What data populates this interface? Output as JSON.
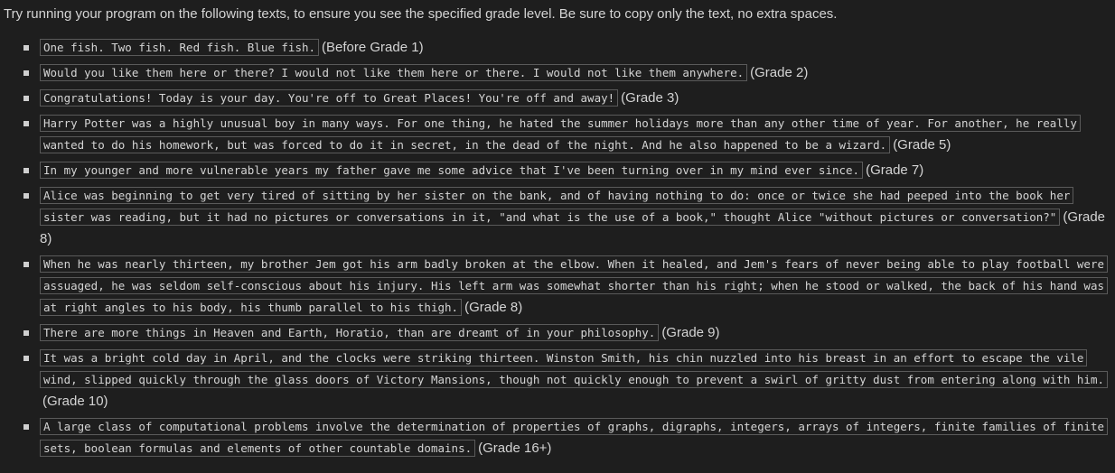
{
  "instructions": "Try running your program on the following texts, to ensure you see the specified grade level. Be sure to copy only the text, no extra spaces.",
  "items": [
    {
      "text": "One fish. Two fish. Red fish. Blue fish.",
      "grade": "(Before Grade 1)"
    },
    {
      "text": "Would you like them here or there? I would not like them here or there. I would not like them anywhere.",
      "grade": "(Grade 2)"
    },
    {
      "text": "Congratulations! Today is your day. You're off to Great Places! You're off and away!",
      "grade": "(Grade 3)"
    },
    {
      "text": "Harry Potter was a highly unusual boy in many ways. For one thing, he hated the summer holidays more than any other time of year. For another, he really wanted to do his homework, but was forced to do it in secret, in the dead of the night. And he also happened to be a wizard.",
      "grade": "(Grade 5)"
    },
    {
      "text": "In my younger and more vulnerable years my father gave me some advice that I've been turning over in my mind ever since.",
      "grade": "(Grade 7)"
    },
    {
      "text": "Alice was beginning to get very tired of sitting by her sister on the bank, and of having nothing to do: once or twice she had peeped into the book her sister was reading, but it had no pictures or conversations in it, \"and what is the use of a book,\" thought Alice \"without pictures or conversation?\"",
      "grade": "(Grade 8)"
    },
    {
      "text": "When he was nearly thirteen, my brother Jem got his arm badly broken at the elbow. When it healed, and Jem's fears of never being able to play football were assuaged, he was seldom self-conscious about his injury. His left arm was somewhat shorter than his right; when he stood or walked, the back of his hand was at right angles to his body, his thumb parallel to his thigh.",
      "grade": "(Grade 8)"
    },
    {
      "text": "There are more things in Heaven and Earth, Horatio, than are dreamt of in your philosophy.",
      "grade": "(Grade 9)"
    },
    {
      "text": "It was a bright cold day in April, and the clocks were striking thirteen. Winston Smith, his chin nuzzled into his breast in an effort to escape the vile wind, slipped quickly through the glass doors of Victory Mansions, though not quickly enough to prevent a swirl of gritty dust from entering along with him.",
      "grade": "(Grade 10)"
    },
    {
      "text": "A large class of computational problems involve the determination of properties of graphs, digraphs, integers, arrays of integers, finite families of finite sets, boolean formulas and elements of other countable domains.",
      "grade": "(Grade 16+)"
    }
  ]
}
